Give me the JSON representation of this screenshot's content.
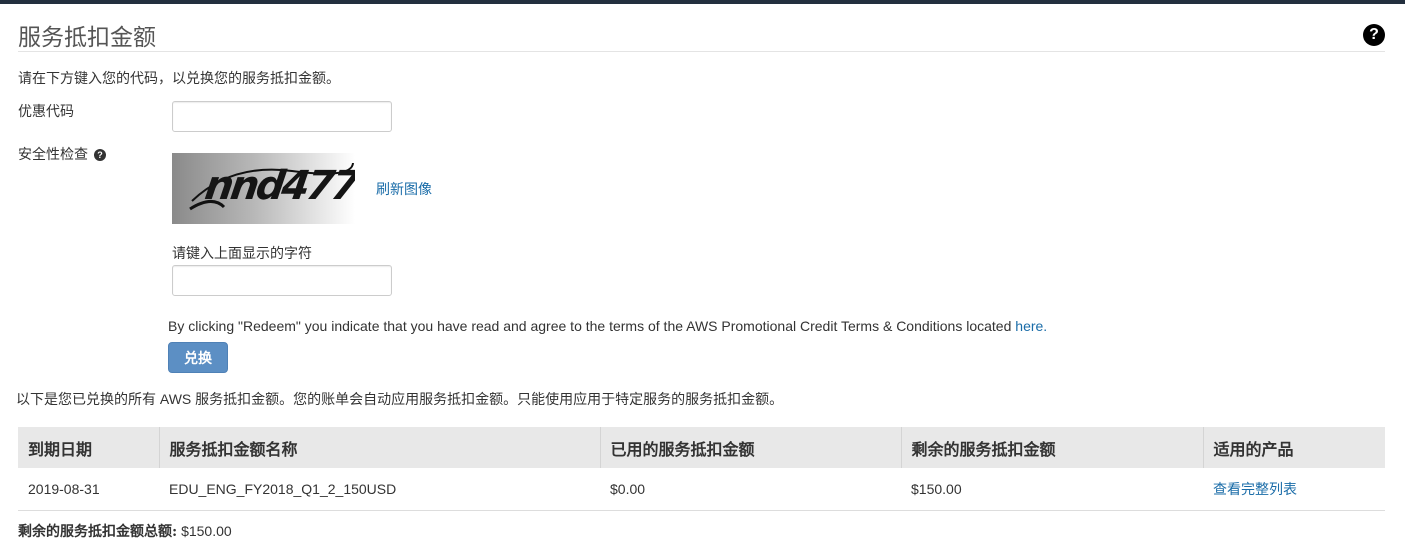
{
  "page": {
    "title": "服务抵扣金额",
    "help_icon": "?",
    "intro": "请在下方键入您的代码，以兑换您的服务抵扣金额。"
  },
  "form": {
    "promo_label": "优惠代码",
    "promo_value": "",
    "security_label": "安全性检查",
    "security_help_icon": "?",
    "captcha_text": "nnd477",
    "refresh_link": "刷新图像",
    "captcha_prompt": "请键入上面显示的字符",
    "captcha_value": "",
    "terms_prefix": "By clicking \"Redeem\" you indicate that you have read and agree to the terms of the AWS Promotional Credit Terms & Conditions located ",
    "terms_link": "here.",
    "redeem_button": "兑换"
  },
  "credits": {
    "summary": "以下是您已兑换的所有 AWS 服务抵扣金额。您的账单会自动应用服务抵扣金额。只能使用应用于特定服务的服务抵扣金额。",
    "columns": [
      "到期日期",
      "服务抵扣金额名称",
      "已用的服务抵扣金额",
      "剩余的服务抵扣金额",
      "适用的产品"
    ],
    "rows": [
      {
        "expiration": "2019-08-31",
        "name": "EDU_ENG_FY2018_Q1_2_150USD",
        "used": "$0.00",
        "remaining": "$150.00",
        "products_link": "查看完整列表"
      }
    ],
    "total_label": "剩余的服务抵扣金额总额:",
    "total_value": "$150.00"
  },
  "colors": {
    "link": "#1a6ca8",
    "button": "#5c8fc4",
    "header_bar": "#232f3e",
    "table_header_bg": "#e8e8e8"
  }
}
